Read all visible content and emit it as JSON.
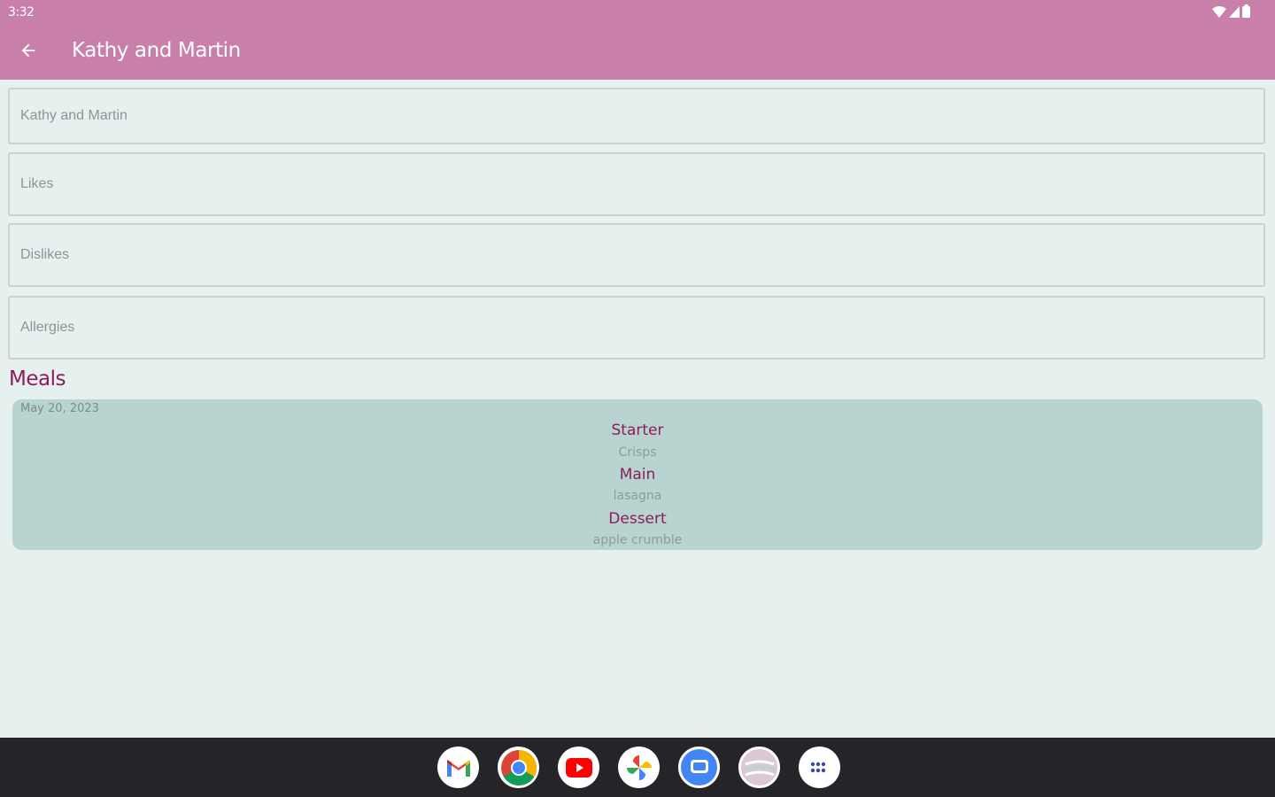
{
  "status_bar": {
    "time": "3:32",
    "icons": [
      "wifi-icon",
      "signal-icon",
      "battery-icon"
    ]
  },
  "app_bar": {
    "back_icon": "arrow-left-icon",
    "title": "Kathy and Martin"
  },
  "form": {
    "name_value": "Kathy and Martin",
    "likes_placeholder": "Likes",
    "dislikes_placeholder": "Dislikes",
    "allergies_placeholder": "Allergies"
  },
  "meals": {
    "section_title": "Meals",
    "items": [
      {
        "date": "May 20, 2023",
        "starter_label": "Starter",
        "starter": "Crisps",
        "main_label": "Main",
        "main": "lasagna",
        "dessert_label": "Dessert",
        "dessert": "apple crumble"
      }
    ]
  },
  "dock": {
    "apps": [
      "gmail-icon",
      "chrome-icon",
      "youtube-icon",
      "photos-icon",
      "messages-icon",
      "app-icon",
      "app-drawer-icon"
    ]
  },
  "colors": {
    "app_bar": "#c880ab",
    "background": "#e6f0ee",
    "accent": "#8c1c5c",
    "card": "#b8d4d1",
    "nav_bar": "#242429"
  }
}
